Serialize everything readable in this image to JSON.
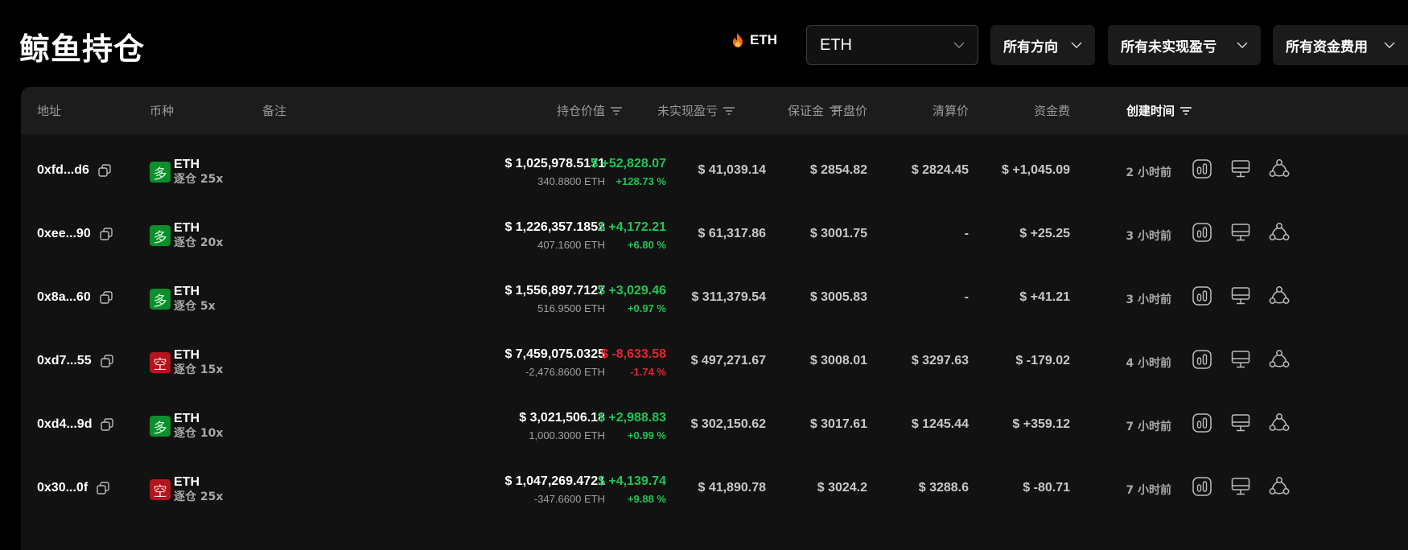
{
  "page": {
    "title": "鲸鱼持仓"
  },
  "hot": {
    "label": "ETH",
    "icon": "fire-icon"
  },
  "filters": {
    "token_value": "ETH",
    "direction": "所有方向",
    "unrealized_pnl": "所有未实现盈亏",
    "funding_fee": "所有资金费用"
  },
  "table": {
    "headers": {
      "address": "地址",
      "coin": "币种",
      "note": "备注",
      "position_value": "持仓价值",
      "unrealized_pnl": "未实现盈亏",
      "margin": "保证金",
      "open_price": "开盘价",
      "liq_price": "清算价",
      "funding": "资金费",
      "created": "创建时间"
    },
    "rows": [
      {
        "address": "0xfd...d6",
        "direction": "多",
        "side": "long",
        "coin": "ETH",
        "leverage": "逐仓 25x",
        "value": "$ 1,025,978.5171",
        "value_sub": "340.8800 ETH",
        "pnl": "$ +52,828.07",
        "pnl_pct": "+128.73 %",
        "pnl_sign": "pos",
        "margin": "$ 41,039.14",
        "open": "$ 2854.82",
        "liq": "$ 2824.45",
        "fee": "$ +1,045.09",
        "fee_sign": "pos",
        "time": "2 小时前"
      },
      {
        "address": "0xee...90",
        "direction": "多",
        "side": "long",
        "coin": "ETH",
        "leverage": "逐仓 20x",
        "value": "$ 1,226,357.1852",
        "value_sub": "407.1600 ETH",
        "pnl": "$ +4,172.21",
        "pnl_pct": "+6.80 %",
        "pnl_sign": "pos",
        "margin": "$ 61,317.86",
        "open": "$ 3001.75",
        "liq": "-",
        "fee": "$ +25.25",
        "fee_sign": "pos",
        "time": "3 小时前"
      },
      {
        "address": "0x8a...60",
        "direction": "多",
        "side": "long",
        "coin": "ETH",
        "leverage": "逐仓 5x",
        "value": "$ 1,556,897.7127",
        "value_sub": "516.9500 ETH",
        "pnl": "$ +3,029.46",
        "pnl_pct": "+0.97 %",
        "pnl_sign": "pos",
        "margin": "$ 311,379.54",
        "open": "$ 3005.83",
        "liq": "-",
        "fee": "$ +41.21",
        "fee_sign": "pos",
        "time": "3 小时前"
      },
      {
        "address": "0xd7...55",
        "direction": "空",
        "side": "short",
        "coin": "ETH",
        "leverage": "逐仓 15x",
        "value": "$ 7,459,075.0325",
        "value_sub": "-2,476.8600 ETH",
        "pnl": "$ -8,633.58",
        "pnl_pct": "-1.74 %",
        "pnl_sign": "neg",
        "margin": "$ 497,271.67",
        "open": "$ 3008.01",
        "liq": "$ 3297.63",
        "fee": "$ -179.02",
        "fee_sign": "neg",
        "time": "4 小时前"
      },
      {
        "address": "0xd4...9d",
        "direction": "多",
        "side": "long",
        "coin": "ETH",
        "leverage": "逐仓 10x",
        "value": "$ 3,021,506.18",
        "value_sub": "1,000.3000 ETH",
        "pnl": "$ +2,988.83",
        "pnl_pct": "+0.99 %",
        "pnl_sign": "pos",
        "margin": "$ 302,150.62",
        "open": "$ 3017.61",
        "liq": "$ 1245.44",
        "fee": "$ +359.12",
        "fee_sign": "pos",
        "time": "7 小时前"
      },
      {
        "address": "0x30...0f",
        "direction": "空",
        "side": "short",
        "coin": "ETH",
        "leverage": "逐仓 25x",
        "value": "$ 1,047,269.4721",
        "value_sub": "-347.6600 ETH",
        "pnl": "$ +4,139.74",
        "pnl_pct": "+9.88 %",
        "pnl_sign": "pos",
        "margin": "$ 41,890.78",
        "open": "$ 3024.2",
        "liq": "$ 3288.6",
        "fee": "$ -80.71",
        "fee_sign": "neg",
        "time": "7 小时前"
      }
    ]
  },
  "colors": {
    "positive": "#20c653",
    "negative": "#e2262f",
    "long_badge": "#0c8e2c",
    "short_badge": "#b3141d"
  }
}
